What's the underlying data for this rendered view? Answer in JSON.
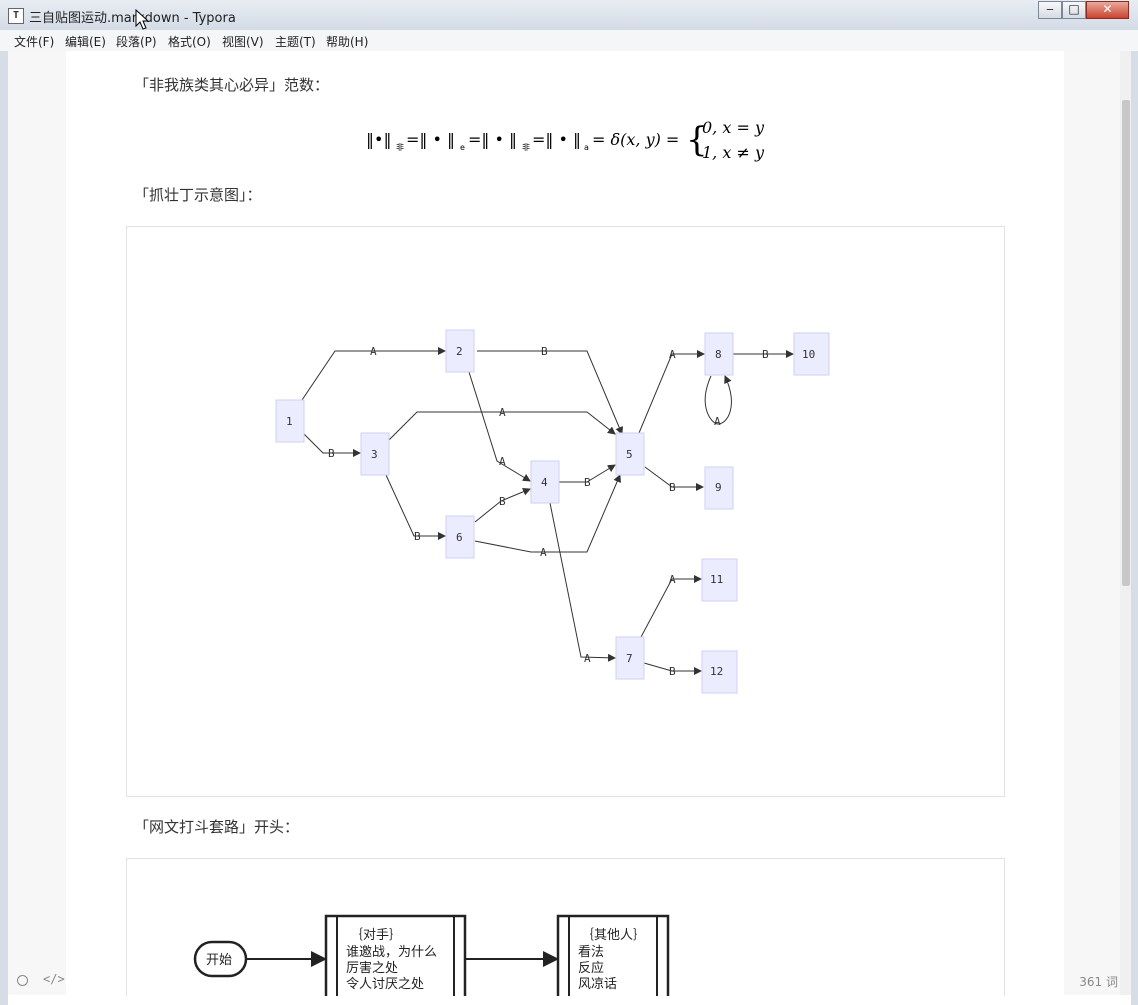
{
  "window": {
    "title": "三自贴图运动.markdown - Typora",
    "app_icon": "T",
    "buttons": {
      "minimize": "▭",
      "maximize": "□",
      "close": "✕"
    }
  },
  "menu": {
    "items": [
      "文件(F)",
      "编辑(E)",
      "段落(P)",
      "格式(O)",
      "视图(V)",
      "主题(T)",
      "帮助(H)"
    ]
  },
  "doc": {
    "p1": "「非我族类其心必异」范数：",
    "formula": {
      "lhs": "‖•‖",
      "subs": [
        "非",
        "e",
        "非",
        "a"
      ],
      "delta": "= δ(x, y) =",
      "case1": "0, x = y",
      "case2": "1, x ≠ y"
    },
    "p2": "「抓壮丁示意图」：",
    "p3": "「网文打斗套路」开头："
  },
  "graph1": {
    "nodes": [
      "1",
      "2",
      "3",
      "4",
      "5",
      "6",
      "7",
      "8",
      "9",
      "10",
      "11",
      "12"
    ],
    "edge_labels": [
      "A",
      "B"
    ]
  },
  "flow": {
    "start": "开始",
    "box1": [
      "｛对手｝",
      "谁邀战，为什么",
      "厉害之处",
      "令人讨厌之处"
    ],
    "box2": [
      "｛其他人｝",
      "看法",
      "反应",
      "风凉话"
    ]
  },
  "status": {
    "word_count": "361 词",
    "source_icon": "</>"
  }
}
